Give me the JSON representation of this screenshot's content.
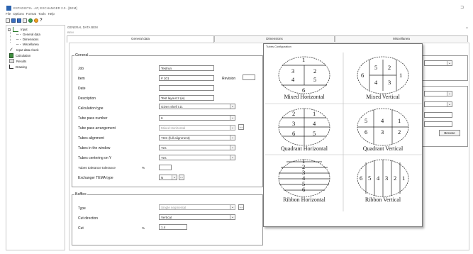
{
  "window": {
    "title": "ESTADISTIA - AP, EXCHANGER 2.0 - [BEM]"
  },
  "menu": {
    "items": [
      "File",
      "Options",
      "Format",
      "Tools",
      "Help"
    ]
  },
  "tree": {
    "input": "Input",
    "general": "General data",
    "dimensions": "Dimensions",
    "miscellanea": "Miscellanea",
    "input_check": "Input data check",
    "calculation": "Calculation",
    "results": "Results",
    "drawing": "Drawing"
  },
  "document": {
    "title": "GENERAL DATA BEM",
    "caption": "BEM",
    "close": "×",
    "tabs": [
      "General data",
      "Dimensions",
      "Miscellanea"
    ]
  },
  "general": {
    "group_title": "General",
    "job_label": "Job",
    "job_value": "Testrun",
    "item_label": "Item",
    "item_value": "# 101",
    "revision_label": "Revision",
    "revision_value": "",
    "date_label": "Date",
    "date_value": "",
    "description_label": "Description",
    "description_value": "Test layout 2 (w)",
    "calc_type_label": "Calculation type",
    "calc_type_value": "Given shell I.D.",
    "tube_passes_label": "Tube pass number",
    "tube_passes_value": "6",
    "tube_arrangement_label": "Tube pass arrangement",
    "tube_arrangement_value": "Mixed Horizontal",
    "tube_alignment_label": "Tubes alignment",
    "tube_alignment_value": "YES (full alignment)",
    "tubes_window_label": "Tubes in the window",
    "tubes_window_value": "Yes",
    "tubes_centering_label": "Tubes centering on Y",
    "tubes_centering_value": "Yes",
    "tubes_tolerance_label": "Tubes tolerance tolerance",
    "tubes_tolerance_unit": "%",
    "tubes_tolerance_value": "",
    "tema_label": "Exchanger TEMA type",
    "tema_value": "N",
    "minibtn": "..."
  },
  "baffles": {
    "group_title": "Baffles",
    "type_label": "Type",
    "type_value": "Single segmental",
    "cut_direction_label": "Cut direction",
    "cut_direction_value": "Vertical",
    "cut_label": "Cut",
    "cut_unit": "%",
    "cut_value": "1.4"
  },
  "right_panel": {
    "browse_label": "Browse"
  },
  "popup": {
    "title": "Tubes Configuration",
    "options": [
      {
        "caption": "Mixed Horizontal",
        "numbers": [
          "1",
          "2",
          "3",
          "4",
          "5",
          "6"
        ]
      },
      {
        "caption": "Mixed Vertical",
        "numbers": [
          "1",
          "2",
          "3",
          "4",
          "5",
          "6"
        ]
      },
      {
        "caption": "Quadrant Horizontal",
        "numbers": [
          "1",
          "2",
          "3",
          "4",
          "5",
          "6"
        ]
      },
      {
        "caption": "Quadrant Vertical",
        "numbers": [
          "1",
          "2",
          "3",
          "4",
          "5",
          "6"
        ]
      },
      {
        "caption": "Ribbon Horizontal",
        "numbers": [
          "1",
          "2",
          "3",
          "4",
          "5",
          "6"
        ]
      },
      {
        "caption": "Ribbon Vertical",
        "numbers": [
          "1",
          "2",
          "3",
          "4",
          "5",
          "6"
        ]
      }
    ]
  },
  "colors": {
    "accent": "#2a63b0",
    "tree_green": "#2b7a2b"
  }
}
